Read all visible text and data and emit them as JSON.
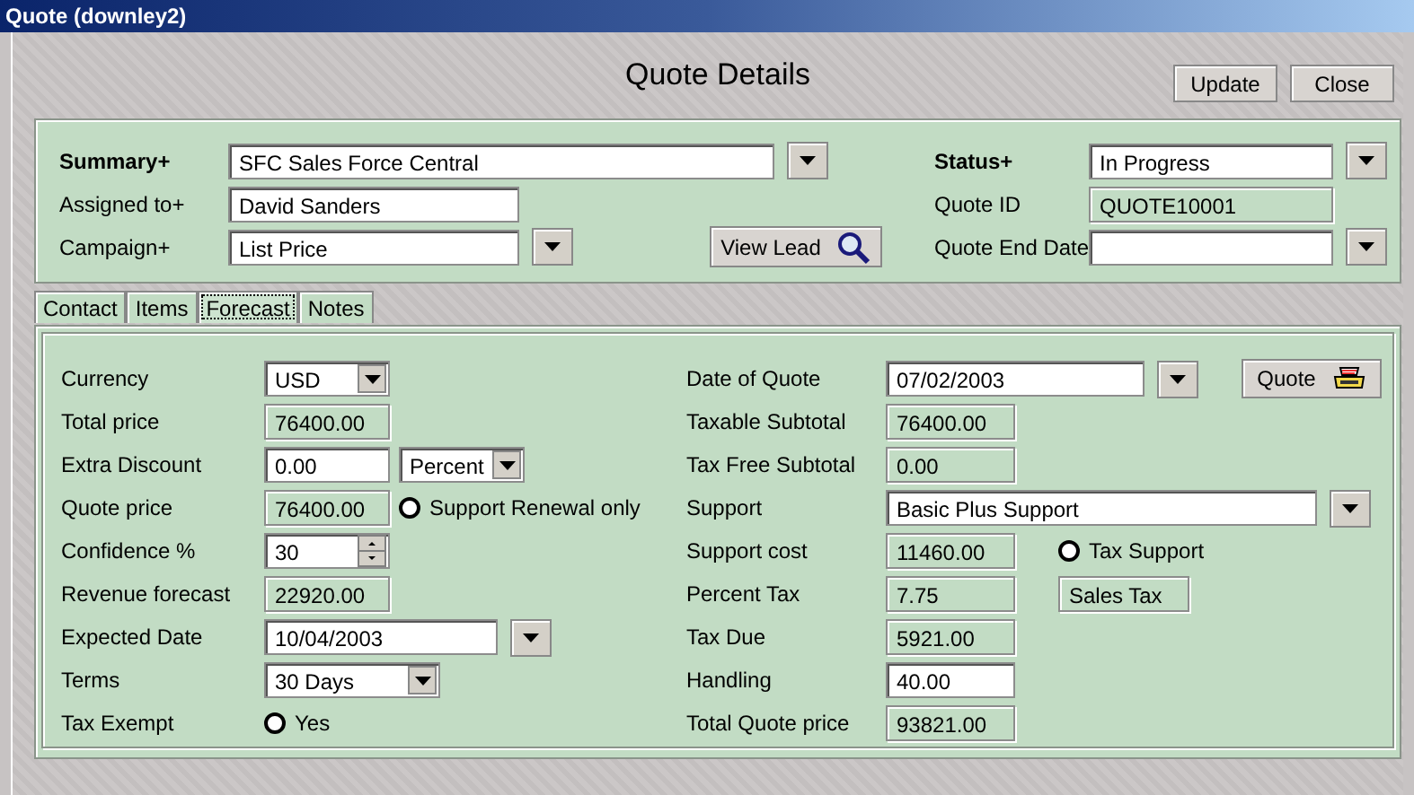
{
  "window": {
    "title": "Quote (downley2)"
  },
  "header": {
    "title": "Quote Details",
    "buttons": [
      "Update",
      "Close"
    ]
  },
  "summary": {
    "left": [
      {
        "label": "Summary+",
        "bold": true,
        "kind": "picker",
        "value": "SFC Sales Force Central"
      },
      {
        "label": "Assigned to+",
        "bold": false,
        "kind": "input",
        "value": "David Sanders"
      },
      {
        "label": "Campaign+",
        "bold": false,
        "kind": "picker",
        "value": "List Price"
      }
    ],
    "view_lead": "View Lead",
    "right": [
      {
        "label": "Status+",
        "bold": true,
        "kind": "picker",
        "value": "In Progress"
      },
      {
        "label": "Quote ID",
        "bold": false,
        "kind": "readonly",
        "value": "QUOTE10001"
      },
      {
        "label": "Quote End Date",
        "bold": false,
        "kind": "picker"
      }
    ]
  },
  "tabs": [
    {
      "label": "Contact",
      "selected": false
    },
    {
      "label": "Items",
      "selected": false
    },
    {
      "label": "Forecast",
      "selected": true
    },
    {
      "label": "Notes",
      "selected": false
    }
  ],
  "forecast": {
    "left": [
      {
        "label": "Currency",
        "kind": "combo",
        "value": "USD"
      },
      {
        "label": "Total price",
        "kind": "readonly",
        "value": "76400.00"
      },
      {
        "label": "Extra Discount",
        "kind": "input",
        "value": "0.00",
        "extra": {
          "kind": "combo",
          "value": "Percent"
        }
      },
      {
        "label": "Quote price",
        "kind": "readonly",
        "value": "76400.00",
        "extra": {
          "kind": "radio",
          "value": "Support Renewal only",
          "checked": false
        }
      },
      {
        "label": "Confidence %",
        "kind": "spin",
        "value": "30"
      },
      {
        "label": "Revenue forecast",
        "kind": "readonly",
        "value": "22920.00"
      },
      {
        "label": "Expected Date",
        "kind": "picker",
        "value": "10/04/2003"
      },
      {
        "label": "Terms",
        "kind": "combo",
        "value": "30 Days"
      },
      {
        "label": "Tax Exempt",
        "kind": "radio",
        "value": "Yes",
        "checked": false
      }
    ],
    "right": [
      {
        "label": "Date of Quote",
        "kind": "picker",
        "value": "07/02/2003",
        "extra": {
          "kind": "button",
          "value": "Quote"
        }
      },
      {
        "label": "Taxable Subtotal",
        "kind": "readonly",
        "value": "76400.00"
      },
      {
        "label": "Tax Free Subtotal",
        "kind": "readonly",
        "value": "0.00"
      },
      {
        "label": "Support",
        "kind": "picker",
        "value": "Basic Plus Support"
      },
      {
        "label": "Support cost",
        "kind": "readonly",
        "value": "11460.00",
        "extra": {
          "kind": "radio",
          "value": "Tax Support",
          "checked": false
        }
      },
      {
        "label": "Percent Tax",
        "kind": "readonly",
        "value": "7.75",
        "extra": {
          "kind": "readonly",
          "value": "Sales Tax"
        }
      },
      {
        "label": "Tax Due",
        "kind": "readonly",
        "value": "5921.00"
      },
      {
        "label": "Handling",
        "kind": "input",
        "value": "40.00"
      },
      {
        "label": "Total Quote price",
        "kind": "readonly",
        "value": "93821.00"
      }
    ]
  }
}
